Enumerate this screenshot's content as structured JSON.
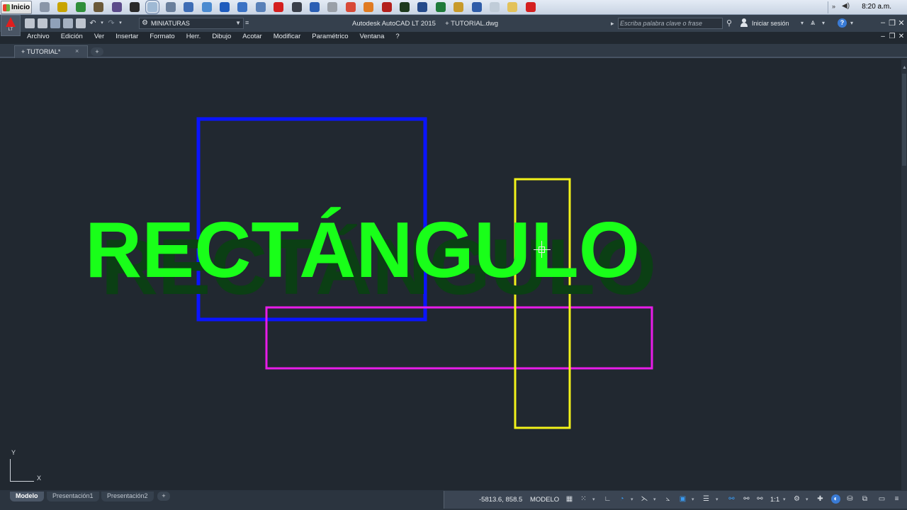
{
  "taskbar": {
    "start_label": "Inicio",
    "time": "8:20 a.m.",
    "icons": [
      {
        "name": "explorer-icon",
        "color": "#8a96a8"
      },
      {
        "name": "yellow-circle-icon",
        "color": "#c8a400"
      },
      {
        "name": "green-leaf-icon",
        "color": "#2f8f3a"
      },
      {
        "name": "animal-icon",
        "color": "#6b5a3a"
      },
      {
        "name": "pen-icon",
        "color": "#5b4b8a"
      },
      {
        "name": "headphones-icon",
        "color": "#2a2a2a"
      },
      {
        "name": "notepad-icon",
        "color": "#9fb9d4"
      },
      {
        "name": "tools-icon",
        "color": "#6a7f9c"
      },
      {
        "name": "network-icon",
        "color": "#3e6db5"
      },
      {
        "name": "monitor-icon",
        "color": "#4a8ad0"
      },
      {
        "name": "globe-icon",
        "color": "#1e5bbd"
      },
      {
        "name": "users-icon",
        "color": "#3b72c4"
      },
      {
        "name": "settings-icon",
        "color": "#5880b8"
      },
      {
        "name": "autocad-icon",
        "color": "#d42020"
      },
      {
        "name": "arrow-icon",
        "color": "#3a3f4a"
      },
      {
        "name": "word-icon",
        "color": "#2b5fb4"
      },
      {
        "name": "disk-icon",
        "color": "#9aa0a8"
      },
      {
        "name": "chrome-icon",
        "color": "#d84a38"
      },
      {
        "name": "media-icon",
        "color": "#e07b22"
      },
      {
        "name": "pdf-icon",
        "color": "#b3201c"
      },
      {
        "name": "terminal-icon",
        "color": "#1d3a1d"
      },
      {
        "name": "presentation-icon",
        "color": "#254a8a"
      },
      {
        "name": "excel-icon",
        "color": "#1f7a3a"
      },
      {
        "name": "pencil-icon",
        "color": "#c89a2a"
      },
      {
        "name": "image-icon",
        "color": "#2f5ca8"
      },
      {
        "name": "document-icon",
        "color": "#c0ccd8"
      },
      {
        "name": "folder-icon",
        "color": "#e3c25a"
      },
      {
        "name": "autocad-lt-icon",
        "color": "#d42020"
      }
    ]
  },
  "app": {
    "title": "Autodesk AutoCAD LT 2015     + TUTORIAL.dwg",
    "app_button_label": "LT",
    "workspace": "MINIATURAS",
    "search_placeholder": "Escriba palabra clave o frase",
    "signin_label": "Iniciar sesión",
    "help_label": "?",
    "accent_color": "#e01e1e"
  },
  "menubar": {
    "items": [
      "Archivo",
      "Edición",
      "Ver",
      "Insertar",
      "Formato",
      "Herr.",
      "Dibujo",
      "Acotar",
      "Modificar",
      "Paramétrico",
      "Ventana",
      "?"
    ]
  },
  "doc_tabs": {
    "active_tab": "+ TUTORIAL*",
    "close_label": "×",
    "new_label": "+"
  },
  "canvas": {
    "background": "#212830",
    "overlay_title": "RECTÁNGULO",
    "overlay_color": "#19ff19",
    "rectangles": [
      {
        "name": "blue-rectangle",
        "color": "#0a14ff"
      },
      {
        "name": "magenta-rectangle",
        "color": "#e81ce8"
      },
      {
        "name": "yellow-rectangle",
        "color": "#f2f21a"
      }
    ],
    "ucs": {
      "x_label": "X",
      "y_label": "Y"
    }
  },
  "layout_tabs": {
    "tabs": [
      "Modelo",
      "Presentación1",
      "Presentación2"
    ],
    "active": "Modelo",
    "add_label": "+"
  },
  "statusbar": {
    "coordinates": "-5813.6, 858.5",
    "space": "MODELO",
    "scale": "1:1"
  }
}
